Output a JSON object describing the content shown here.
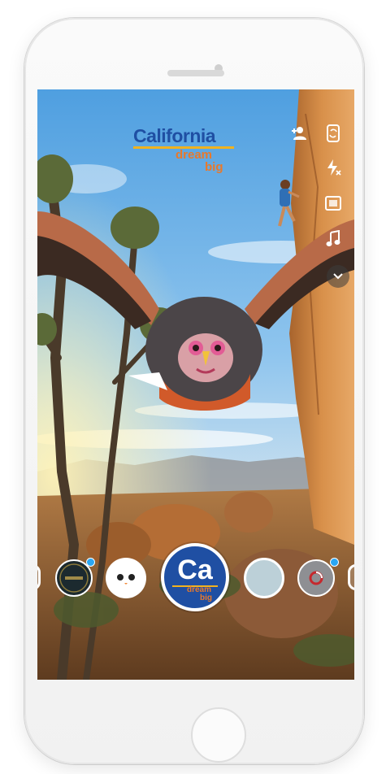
{
  "lens_brand": {
    "word": "California",
    "tagline_1": "dream",
    "tagline_2": "big"
  },
  "selected_lens": {
    "initials": "Ca",
    "tagline_1": "dream",
    "tagline_2": "big"
  },
  "lens_carousel": [
    {
      "icon": "lens-dark-badge-icon",
      "badge": true
    },
    {
      "icon": "lens-cute-face-icon",
      "badge": false
    },
    {
      "icon": "lens-california-icon",
      "selected": true
    },
    {
      "icon": "lens-pale-blue-icon",
      "badge": false
    },
    {
      "icon": "lens-red-swirl-icon",
      "badge": true
    }
  ],
  "toolbar_icons": [
    "add-friend-icon",
    "flip-camera-icon",
    "flash-off-icon",
    "video-chat-icon",
    "music-icon",
    "chevron-down-icon"
  ],
  "colors": {
    "brand_blue": "#1f4fa3",
    "brand_orange": "#e8792b",
    "brand_gold": "#f0b21f",
    "badge_blue": "#2aa6f2"
  }
}
